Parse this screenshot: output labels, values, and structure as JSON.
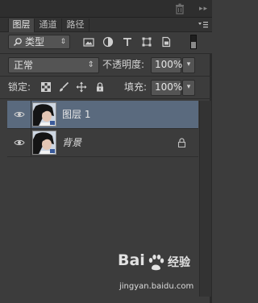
{
  "panel": {
    "tabs": [
      {
        "label": "图层",
        "active": true
      },
      {
        "label": "通道",
        "active": false
      },
      {
        "label": "路径",
        "active": false
      }
    ]
  },
  "filter": {
    "kind_label": "类型",
    "icons": [
      "image-filter-icon",
      "adjustment-filter-icon",
      "type-filter-icon",
      "shape-filter-icon",
      "smart-object-filter-icon"
    ]
  },
  "blend": {
    "mode": "正常",
    "opacity_label": "不透明度:",
    "opacity_value": "100%"
  },
  "lock": {
    "label": "锁定:",
    "fill_label": "填充:",
    "fill_value": "100%"
  },
  "layers": [
    {
      "name": "图层 1",
      "selected": true,
      "locked": false
    },
    {
      "name": "背景",
      "selected": false,
      "locked": true
    }
  ],
  "watermark": {
    "brand": "Bai",
    "brand2": "经验",
    "url": "jingyan.baidu.com"
  },
  "colors": {
    "panel_bg": "#3c3c3c",
    "selected_layer": "#5a6a7e",
    "field_bg": "#545454"
  }
}
